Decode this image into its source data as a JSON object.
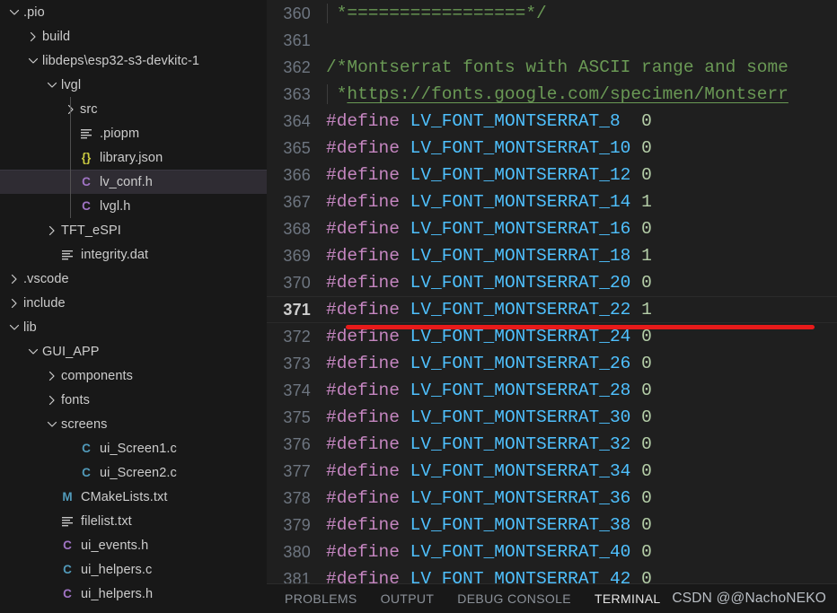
{
  "colors": {
    "sidebar_bg": "#181818",
    "editor_bg": "#1f1f1f",
    "panel_bg": "#181818",
    "selection_bg": "#2f2c33",
    "comment": "#6a9955",
    "preprocessor": "#c586c0",
    "macro_name": "#4fc1ff",
    "number": "#b5cea8",
    "line_number": "#6e7681",
    "active_line_number": "#cccccc",
    "annotation_red": "#e81a1a"
  },
  "sidebar": {
    "items": [
      {
        "label": ".pio",
        "depth": 0,
        "twisty": "chevron-down-icon",
        "icon": "none",
        "icon_color": "",
        "selected": false
      },
      {
        "label": "build",
        "depth": 1,
        "twisty": "chevron-right-icon",
        "icon": "none",
        "icon_color": "",
        "selected": false
      },
      {
        "label": "libdeps\\esp32-s3-devkitc-1",
        "depth": 1,
        "twisty": "chevron-down-icon",
        "icon": "none",
        "icon_color": "",
        "selected": false
      },
      {
        "label": "lvgl",
        "depth": 2,
        "twisty": "chevron-down-icon",
        "icon": "none",
        "icon_color": "",
        "selected": false
      },
      {
        "label": "src",
        "depth": 3,
        "twisty": "chevron-right-icon",
        "icon": "none",
        "icon_color": "",
        "selected": false
      },
      {
        "label": ".piopm",
        "depth": 3,
        "twisty": "none",
        "icon": "lines-file-icon",
        "icon_color": "c-gray",
        "selected": false
      },
      {
        "label": "library.json",
        "depth": 3,
        "twisty": "none",
        "icon": "json-icon",
        "icon_color": "c-yellow",
        "selected": false
      },
      {
        "label": "lv_conf.h",
        "depth": 3,
        "twisty": "none",
        "icon": "c-header-icon",
        "icon_color": "c-purple",
        "selected": true
      },
      {
        "label": "lvgl.h",
        "depth": 3,
        "twisty": "none",
        "icon": "c-header-icon",
        "icon_color": "c-purple",
        "selected": false
      },
      {
        "label": "TFT_eSPI",
        "depth": 2,
        "twisty": "chevron-right-icon",
        "icon": "none",
        "icon_color": "",
        "selected": false
      },
      {
        "label": "integrity.dat",
        "depth": 2,
        "twisty": "none",
        "icon": "lines-file-icon",
        "icon_color": "c-gray",
        "selected": false
      },
      {
        "label": ".vscode",
        "depth": 0,
        "twisty": "chevron-right-icon",
        "icon": "none",
        "icon_color": "",
        "selected": false
      },
      {
        "label": "include",
        "depth": 0,
        "twisty": "chevron-right-icon",
        "icon": "none",
        "icon_color": "",
        "selected": false
      },
      {
        "label": "lib",
        "depth": 0,
        "twisty": "chevron-down-icon",
        "icon": "none",
        "icon_color": "",
        "selected": false
      },
      {
        "label": "GUI_APP",
        "depth": 1,
        "twisty": "chevron-down-icon",
        "icon": "none",
        "icon_color": "",
        "selected": false
      },
      {
        "label": "components",
        "depth": 2,
        "twisty": "chevron-right-icon",
        "icon": "none",
        "icon_color": "",
        "selected": false
      },
      {
        "label": "fonts",
        "depth": 2,
        "twisty": "chevron-right-icon",
        "icon": "none",
        "icon_color": "",
        "selected": false
      },
      {
        "label": "screens",
        "depth": 2,
        "twisty": "chevron-down-icon",
        "icon": "none",
        "icon_color": "",
        "selected": false
      },
      {
        "label": "ui_Screen1.c",
        "depth": 3,
        "twisty": "none",
        "icon": "c-source-icon",
        "icon_color": "c-blue",
        "selected": false
      },
      {
        "label": "ui_Screen2.c",
        "depth": 3,
        "twisty": "none",
        "icon": "c-source-icon",
        "icon_color": "c-blue",
        "selected": false
      },
      {
        "label": "CMakeLists.txt",
        "depth": 2,
        "twisty": "none",
        "icon": "cmake-icon",
        "icon_color": "c-info",
        "selected": false
      },
      {
        "label": "filelist.txt",
        "depth": 2,
        "twisty": "none",
        "icon": "lines-file-icon",
        "icon_color": "c-gray",
        "selected": false
      },
      {
        "label": "ui_events.h",
        "depth": 2,
        "twisty": "none",
        "icon": "c-header-icon",
        "icon_color": "c-purple",
        "selected": false
      },
      {
        "label": "ui_helpers.c",
        "depth": 2,
        "twisty": "none",
        "icon": "c-source-icon",
        "icon_color": "c-blue",
        "selected": false
      },
      {
        "label": "ui_helpers.h",
        "depth": 2,
        "twisty": "none",
        "icon": "c-header-icon",
        "icon_color": "c-purple",
        "selected": false
      }
    ]
  },
  "editor": {
    "active_line": 371,
    "lines": [
      {
        "num": "360",
        "guide": true,
        "tokens": [
          {
            "t": " *=================*/",
            "c": "tok-comment"
          }
        ]
      },
      {
        "num": "361",
        "guide": true,
        "tokens": []
      },
      {
        "num": "362",
        "guide": false,
        "tokens": [
          {
            "t": "/*Montserrat fonts with ASCII range and some",
            "c": "tok-comment"
          }
        ]
      },
      {
        "num": "363",
        "guide": true,
        "tokens": [
          {
            "t": " *",
            "c": "tok-comment"
          },
          {
            "t": "https://fonts.google.com/specimen/Montserr",
            "c": "tok-link"
          }
        ]
      },
      {
        "num": "364",
        "guide": false,
        "tokens": [
          {
            "t": "#define ",
            "c": "tok-define"
          },
          {
            "t": "LV_FONT_MONTSERRAT_8  ",
            "c": "tok-macro"
          },
          {
            "t": "0",
            "c": "tok-num"
          }
        ]
      },
      {
        "num": "365",
        "guide": false,
        "tokens": [
          {
            "t": "#define ",
            "c": "tok-define"
          },
          {
            "t": "LV_FONT_MONTSERRAT_10 ",
            "c": "tok-macro"
          },
          {
            "t": "0",
            "c": "tok-num"
          }
        ]
      },
      {
        "num": "366",
        "guide": false,
        "tokens": [
          {
            "t": "#define ",
            "c": "tok-define"
          },
          {
            "t": "LV_FONT_MONTSERRAT_12 ",
            "c": "tok-macro"
          },
          {
            "t": "0",
            "c": "tok-num"
          }
        ]
      },
      {
        "num": "367",
        "guide": false,
        "tokens": [
          {
            "t": "#define ",
            "c": "tok-define"
          },
          {
            "t": "LV_FONT_MONTSERRAT_14 ",
            "c": "tok-macro"
          },
          {
            "t": "1",
            "c": "tok-num"
          }
        ]
      },
      {
        "num": "368",
        "guide": false,
        "tokens": [
          {
            "t": "#define ",
            "c": "tok-define"
          },
          {
            "t": "LV_FONT_MONTSERRAT_16 ",
            "c": "tok-macro"
          },
          {
            "t": "0",
            "c": "tok-num"
          }
        ]
      },
      {
        "num": "369",
        "guide": false,
        "tokens": [
          {
            "t": "#define ",
            "c": "tok-define"
          },
          {
            "t": "LV_FONT_MONTSERRAT_18 ",
            "c": "tok-macro"
          },
          {
            "t": "1",
            "c": "tok-num"
          }
        ]
      },
      {
        "num": "370",
        "guide": false,
        "tokens": [
          {
            "t": "#define ",
            "c": "tok-define"
          },
          {
            "t": "LV_FONT_MONTSERRAT_20 ",
            "c": "tok-macro"
          },
          {
            "t": "0",
            "c": "tok-num"
          }
        ]
      },
      {
        "num": "371",
        "guide": false,
        "tokens": [
          {
            "t": "#define ",
            "c": "tok-define"
          },
          {
            "t": "LV_FONT_MONTSERRAT_22 ",
            "c": "tok-macro"
          },
          {
            "t": "1",
            "c": "tok-num"
          }
        ]
      },
      {
        "num": "372",
        "guide": false,
        "tokens": [
          {
            "t": "#define ",
            "c": "tok-define"
          },
          {
            "t": "LV_FONT_MONTSERRAT_24 ",
            "c": "tok-macro"
          },
          {
            "t": "0",
            "c": "tok-num"
          }
        ]
      },
      {
        "num": "373",
        "guide": false,
        "tokens": [
          {
            "t": "#define ",
            "c": "tok-define"
          },
          {
            "t": "LV_FONT_MONTSERRAT_26 ",
            "c": "tok-macro"
          },
          {
            "t": "0",
            "c": "tok-num"
          }
        ]
      },
      {
        "num": "374",
        "guide": false,
        "tokens": [
          {
            "t": "#define ",
            "c": "tok-define"
          },
          {
            "t": "LV_FONT_MONTSERRAT_28 ",
            "c": "tok-macro"
          },
          {
            "t": "0",
            "c": "tok-num"
          }
        ]
      },
      {
        "num": "375",
        "guide": false,
        "tokens": [
          {
            "t": "#define ",
            "c": "tok-define"
          },
          {
            "t": "LV_FONT_MONTSERRAT_30 ",
            "c": "tok-macro"
          },
          {
            "t": "0",
            "c": "tok-num"
          }
        ]
      },
      {
        "num": "376",
        "guide": false,
        "tokens": [
          {
            "t": "#define ",
            "c": "tok-define"
          },
          {
            "t": "LV_FONT_MONTSERRAT_32 ",
            "c": "tok-macro"
          },
          {
            "t": "0",
            "c": "tok-num"
          }
        ]
      },
      {
        "num": "377",
        "guide": false,
        "tokens": [
          {
            "t": "#define ",
            "c": "tok-define"
          },
          {
            "t": "LV_FONT_MONTSERRAT_34 ",
            "c": "tok-macro"
          },
          {
            "t": "0",
            "c": "tok-num"
          }
        ]
      },
      {
        "num": "378",
        "guide": false,
        "tokens": [
          {
            "t": "#define ",
            "c": "tok-define"
          },
          {
            "t": "LV_FONT_MONTSERRAT_36 ",
            "c": "tok-macro"
          },
          {
            "t": "0",
            "c": "tok-num"
          }
        ]
      },
      {
        "num": "379",
        "guide": false,
        "tokens": [
          {
            "t": "#define ",
            "c": "tok-define"
          },
          {
            "t": "LV_FONT_MONTSERRAT_38 ",
            "c": "tok-macro"
          },
          {
            "t": "0",
            "c": "tok-num"
          }
        ]
      },
      {
        "num": "380",
        "guide": false,
        "tokens": [
          {
            "t": "#define ",
            "c": "tok-define"
          },
          {
            "t": "LV_FONT_MONTSERRAT_40 ",
            "c": "tok-macro"
          },
          {
            "t": "0",
            "c": "tok-num"
          }
        ]
      },
      {
        "num": "381",
        "guide": false,
        "tokens": [
          {
            "t": "#define ",
            "c": "tok-define"
          },
          {
            "t": "LV_FONT_MONTSERRAT_42 ",
            "c": "tok-macro"
          },
          {
            "t": "0",
            "c": "tok-num"
          }
        ]
      }
    ]
  },
  "panel": {
    "tabs": [
      {
        "label": "PROBLEMS",
        "active": false
      },
      {
        "label": "OUTPUT",
        "active": false
      },
      {
        "label": "DEBUG CONSOLE",
        "active": false
      },
      {
        "label": "TERMINAL",
        "active": true
      }
    ],
    "watermark": "CSDN @@NachoNEKO"
  }
}
